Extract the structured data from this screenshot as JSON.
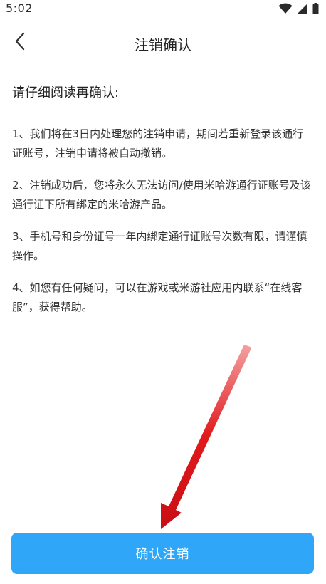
{
  "status_bar": {
    "time": "5:02",
    "icons": [
      "wifi-icon",
      "cellular-signal-icon",
      "battery-icon"
    ]
  },
  "header": {
    "title": "注销确认",
    "back_icon": "chevron-left-icon"
  },
  "content": {
    "intro": "请仔细阅读再确认:",
    "notices": [
      "1、我们将在3日内处理您的注销申请，期间若重新登录该通行证账号，注销申请将被自动撤销。",
      "2、注销成功后，您将永久无法访问/使用米哈游通行证账号及该通行证下所有绑定的米哈游产品。",
      "3、手机号和身份证号一年内绑定通行证账号次数有限，请谨慎操作。",
      "4、如您有任何疑问，可以在游戏或米游社应用内联系“在线客服”，获得帮助。"
    ]
  },
  "footer": {
    "confirm_label": "确认注销"
  },
  "colors": {
    "primary": "#2fa6f7",
    "annotation_arrow": "#e0191c"
  }
}
